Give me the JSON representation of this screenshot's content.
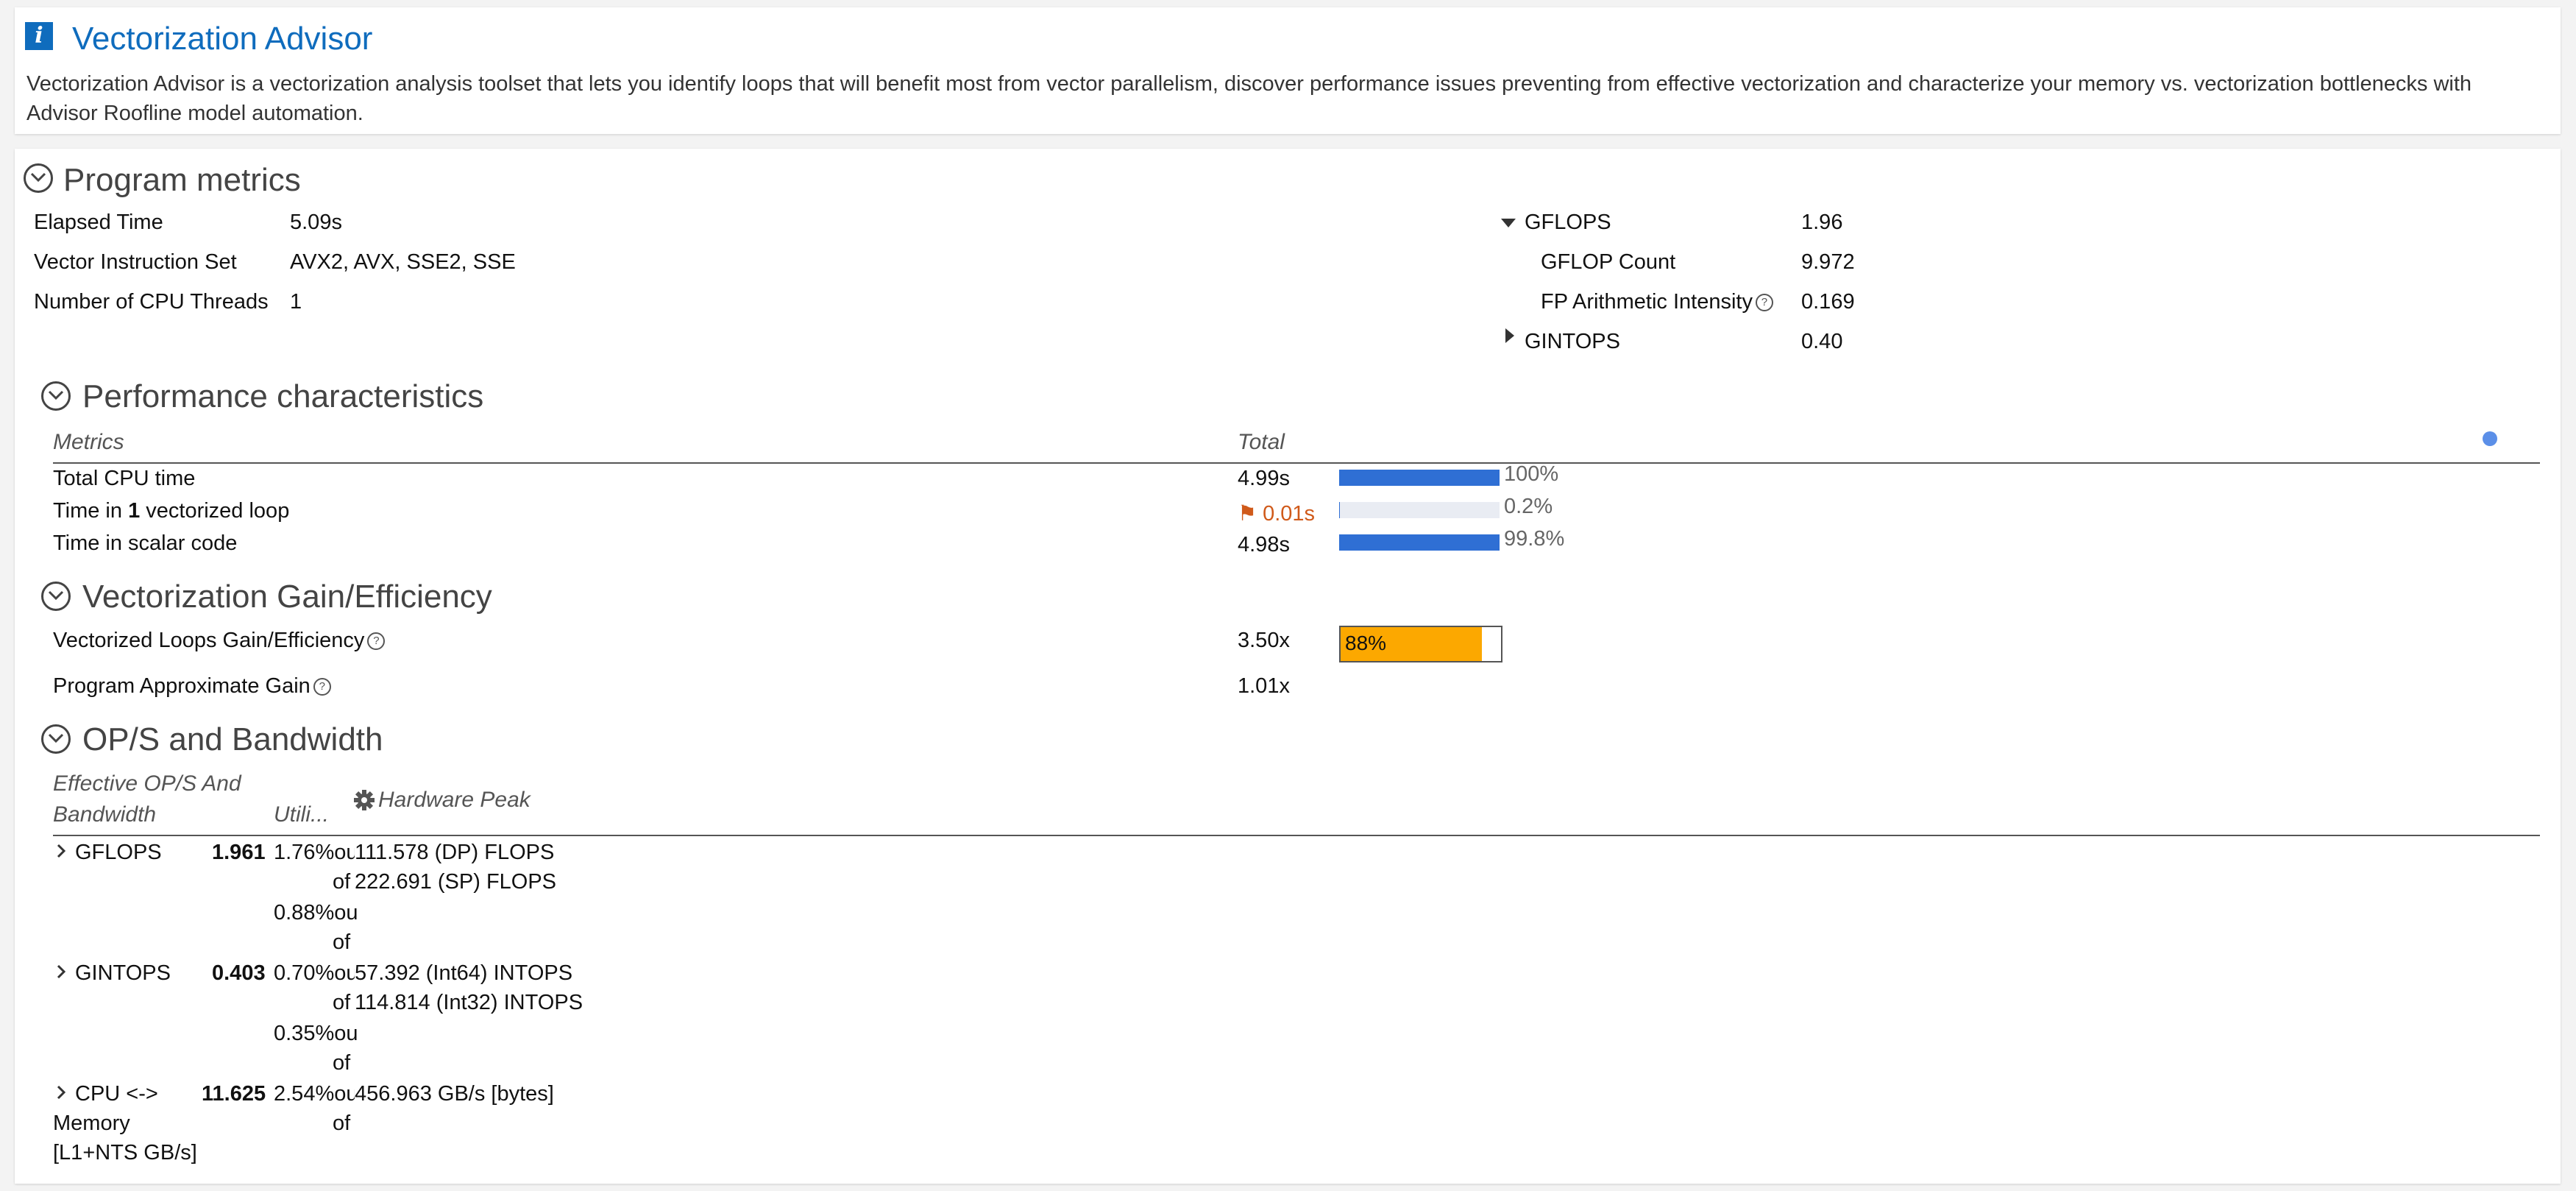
{
  "info": {
    "title": "Vectorization Advisor",
    "icon": "info-icon",
    "description": "Vectorization Advisor is a vectorization analysis toolset that lets you identify loops that will benefit most from vector parallelism, discover performance issues preventing from effective vectorization and characterize your memory vs. vectorization bottlenecks with Advisor Roofline model automation."
  },
  "program_metrics": {
    "title": "Program metrics",
    "left": [
      {
        "label": "Elapsed Time",
        "value": "5.09s"
      },
      {
        "label": "Vector Instruction Set",
        "value": "AVX2, AVX, SSE2, SSE"
      },
      {
        "label": "Number of CPU Threads",
        "value": "1"
      }
    ],
    "gflops": {
      "label": "GFLOPS",
      "value": "1.96"
    },
    "gflop_count": {
      "label": "GFLOP Count",
      "value": "9.972"
    },
    "fp_intensity": {
      "label": "FP Arithmetic Intensity",
      "value": "0.169"
    },
    "gintops": {
      "label": "GINTOPS",
      "value": "0.40"
    }
  },
  "performance": {
    "title": "Performance characteristics",
    "col_metrics": "Metrics",
    "col_total": "Total",
    "rows": [
      {
        "label_pre": "Total CPU time",
        "label_bold": "",
        "label_post": "",
        "value": "4.99s",
        "percent_text": "100%",
        "fraction": 1.0
      },
      {
        "label_pre": "Time in ",
        "label_bold": "1",
        "label_post": " vectorized loop",
        "value": "0.01s",
        "percent_text": "0.2%",
        "fraction": 0.002
      },
      {
        "label_pre": "Time in scalar code",
        "label_bold": "",
        "label_post": "",
        "value": "4.98s",
        "percent_text": "99.8%",
        "fraction": 0.998
      }
    ]
  },
  "vectorization": {
    "title": "Vectorization Gain/Efficiency",
    "loops_gain": {
      "label": "Vectorized Loops Gain/Efficiency",
      "value": "3.50x",
      "efficiency_text": "88%",
      "efficiency": 0.88
    },
    "program_gain": {
      "label": "Program Approximate Gain",
      "value": "1.01x"
    }
  },
  "ops": {
    "title": "OP/S and Bandwidth",
    "col_effective_1": "Effective OP/S And",
    "col_effective_2": "Bandwidth",
    "col_util": "Utili...",
    "col_peak": "Hardware Peak",
    "rows": [
      {
        "name_lines": [
          "GFLOPS"
        ],
        "value": "1.961",
        "util": [
          [
            "1.76%ou",
            "of"
          ],
          [
            "0.88%ou",
            "of"
          ]
        ],
        "peaks": [
          "111.578 (DP) FLOPS",
          "222.691 (SP) FLOPS"
        ]
      },
      {
        "name_lines": [
          "GINTOPS"
        ],
        "value": "0.403",
        "util": [
          [
            "0.70%ou",
            "of"
          ],
          [
            "0.35%ou",
            "of"
          ]
        ],
        "peaks": [
          "57.392 (Int64) INTOPS",
          "114.814 (Int32) INTOPS"
        ]
      },
      {
        "name_lines": [
          "CPU <->",
          "Memory",
          "[L1+NTS GB/s]"
        ],
        "value": "11.625",
        "util": [
          [
            "2.54%ou",
            "of"
          ]
        ],
        "peaks": [
          "456.963 GB/s [bytes]"
        ]
      }
    ]
  },
  "colors": {
    "accent": "#0f6cbd",
    "bar": "#2f6fd4",
    "gain": "#fca800",
    "flag": "#d05a1a"
  }
}
